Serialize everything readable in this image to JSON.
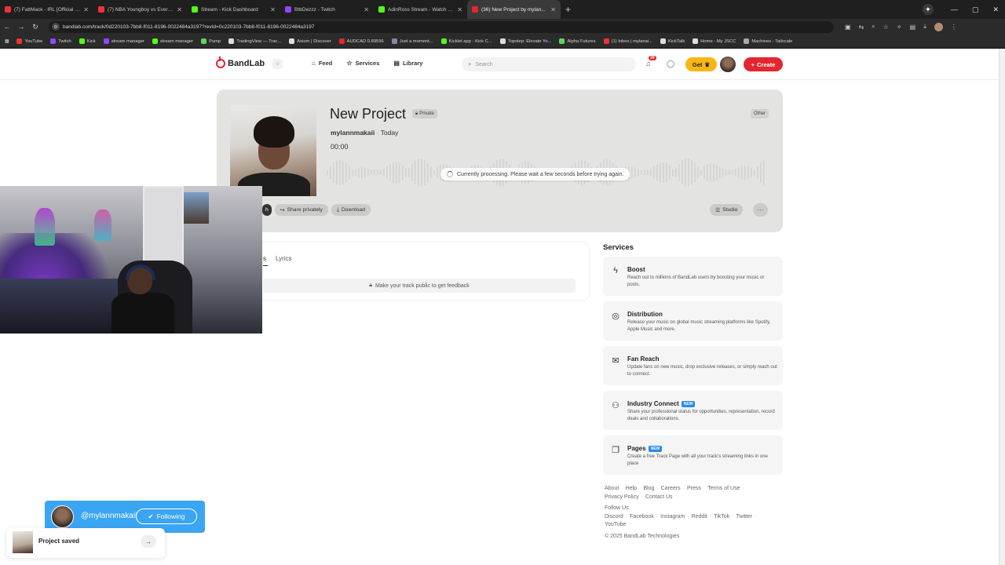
{
  "browser": {
    "tabs": [
      {
        "label": "(7) FattMack - IRL [Official Mus",
        "color": "#e33"
      },
      {
        "label": "(7) NBA Youngboy vs Everybod",
        "color": "#e33"
      },
      {
        "label": "Stream - Kick Dashboard",
        "color": "#53fc18"
      },
      {
        "label": "BtbDezzz - Twitch",
        "color": "#9146ff"
      },
      {
        "label": "AdinRoss Stream - Watch Live o",
        "color": "#53fc18"
      },
      {
        "label": "(36) New Project by mylan...",
        "color": "#e3262f"
      }
    ],
    "url": "bandlab.com/track/0d220103-7bb8-f011-8196-0022484a3197?revId=0c220103-7bb8-f011-8196-0022484a3197",
    "bookmarks": [
      {
        "label": "YouTube",
        "color": "#e33"
      },
      {
        "label": "Twitch",
        "color": "#9146ff"
      },
      {
        "label": "Kick",
        "color": "#53fc18"
      },
      {
        "label": "stream manager",
        "color": "#9146ff"
      },
      {
        "label": "stream manager",
        "color": "#53fc18"
      },
      {
        "label": "Pump",
        "color": "#5fd35f"
      },
      {
        "label": "TradingView — Trac...",
        "color": "#ddd"
      },
      {
        "label": "Axiom | Discover",
        "color": "#ddd"
      },
      {
        "label": "AUDCAD 0.89596",
        "color": "#e3262f"
      },
      {
        "label": "Just a moment...",
        "color": "#88a"
      },
      {
        "label": "Kicklet.app - Kick C...",
        "color": "#53fc18"
      },
      {
        "label": "Topstep: Elevate Yo...",
        "color": "#ddd"
      },
      {
        "label": "Alpha Futures",
        "color": "#5fd35f"
      },
      {
        "label": "(1) Inbox | mylanai...",
        "color": "#e33"
      },
      {
        "label": "KickTalk",
        "color": "#ddd"
      },
      {
        "label": "Home - My JSCC",
        "color": "#ddd"
      },
      {
        "label": "Machines - Tailscale",
        "color": "#aaa"
      }
    ]
  },
  "header": {
    "logo": "BandLab",
    "nav": [
      {
        "label": "Feed",
        "icon": "home-icon"
      },
      {
        "label": "Services",
        "icon": "star-icon"
      },
      {
        "label": "Library",
        "icon": "library-icon"
      }
    ],
    "search_placeholder": "Search",
    "notification_count": "39",
    "get_label": "Get",
    "create_label": "Create"
  },
  "track": {
    "title": "New Project",
    "privacy": "Private",
    "genre": "Other",
    "artist": "mylannmakaii",
    "date": "Today",
    "duration": "00:00",
    "processing_message": "Currently processing. Please wait a few seconds before trying again.",
    "actions": {
      "share_partial": "h",
      "share_privately": "Share privately",
      "download": "Download",
      "studio": "Studio"
    }
  },
  "lower": {
    "tab_comments_partial": "s",
    "tab_lyrics": "Lyrics",
    "feedback_message": "Make your track public to get feedback"
  },
  "services": {
    "title": "Services",
    "items": [
      {
        "name": "Boost",
        "desc": "Reach out to millions of BandLab users by boosting your music or posts.",
        "new": false
      },
      {
        "name": "Distribution",
        "desc": "Release your music on global music streaming platforms like Spotify, Apple Music and more.",
        "new": false
      },
      {
        "name": "Fan Reach",
        "desc": "Update fans on new music, drop exclusive releases, or simply reach out to connect.",
        "new": false
      },
      {
        "name": "Industry Connect",
        "desc": "Share your professional status for opportunities, representation, record deals and collaborations.",
        "new": true
      },
      {
        "name": "Pages",
        "desc": "Create a free Track Page with all your track's streaming links in one place",
        "new": true
      }
    ],
    "new_label": "NEW"
  },
  "footer": {
    "links_row1": [
      "About",
      "Help",
      "Blog",
      "Careers",
      "Press",
      "Terms of Use"
    ],
    "links_row2": [
      "Privacy Policy",
      "Contact Us"
    ],
    "follow_us": "Follow Us",
    "social_row1": [
      "Discord",
      "Facebook",
      "Instagram",
      "Reddit",
      "TikTok",
      "Twitter"
    ],
    "social_row2": [
      "YouTube"
    ],
    "copyright": "© 2025 BandLab Technologies"
  },
  "overlay": {
    "follow_name": "@mylannmakaii",
    "follow_button": "Following"
  },
  "toast": {
    "message": "Project saved"
  }
}
